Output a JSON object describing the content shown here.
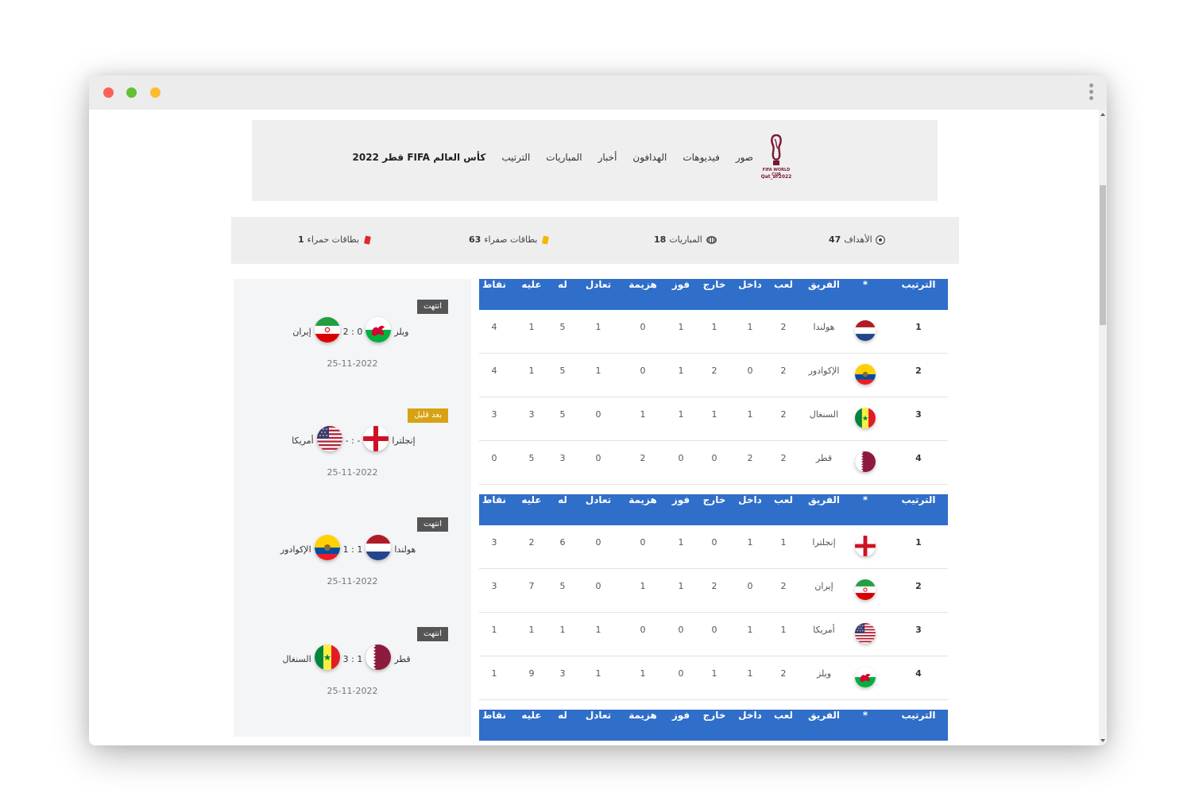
{
  "header": {
    "brand": "كأس العالم FIFA قطر 2022",
    "logo_text_1": "FIFA WORLD CUP",
    "logo_text_2": "Qat_ar2022",
    "nav": [
      "الترتيب",
      "المباريات",
      "أخبار",
      "الهدافون",
      "فيديوهات",
      "صور"
    ]
  },
  "stats": {
    "goals": {
      "label": "الأهداف",
      "value": "47"
    },
    "matches": {
      "label": "المباريات",
      "value": "18"
    },
    "yellow": {
      "label": "بطاقات صفراء",
      "value": "63"
    },
    "red": {
      "label": "بطاقات حمراء",
      "value": "1"
    }
  },
  "colors": {
    "accent": "#2f6ec9",
    "status_done": "#555555",
    "status_soon": "#d8a215"
  },
  "matches": [
    {
      "status": "انتهت",
      "status_type": "done",
      "home": "ويلز",
      "away": "إيران",
      "score": "2 : 0",
      "date": "25-11-2022",
      "home_flag": "wales",
      "away_flag": "iran"
    },
    {
      "status": "بعد قليل",
      "status_type": "soon",
      "home": "إنجلترا",
      "away": "أمريكا",
      "score": "- : -",
      "date": "25-11-2022",
      "home_flag": "england",
      "away_flag": "usa"
    },
    {
      "status": "انتهت",
      "status_type": "done",
      "home": "هولندا",
      "away": "الإكوادور",
      "score": "1 : 1",
      "date": "25-11-2022",
      "home_flag": "netherlands",
      "away_flag": "ecuador"
    },
    {
      "status": "انتهت",
      "status_type": "done",
      "home": "قطر",
      "away": "السنغال",
      "score": "3 : 1",
      "date": "25-11-2022",
      "home_flag": "qatar",
      "away_flag": "senegal"
    }
  ],
  "table_headers": [
    "الترتيب",
    "*",
    "الفريق",
    "لعب",
    "داخل",
    "خارج",
    "فوز",
    "هزيمة",
    "تعادل",
    "له",
    "عليه",
    "نقاط"
  ],
  "groups": [
    {
      "rows": [
        {
          "rank": "1",
          "flag": "netherlands",
          "team": "هولندا",
          "played": "2",
          "home": "1",
          "away": "1",
          "win": "1",
          "loss": "0",
          "draw": "1",
          "gf": "5",
          "ga": "1",
          "pts": "4"
        },
        {
          "rank": "2",
          "flag": "ecuador",
          "team": "الإكوادور",
          "played": "2",
          "home": "0",
          "away": "2",
          "win": "1",
          "loss": "0",
          "draw": "1",
          "gf": "5",
          "ga": "1",
          "pts": "4"
        },
        {
          "rank": "3",
          "flag": "senegal",
          "team": "السنغال",
          "played": "2",
          "home": "1",
          "away": "1",
          "win": "1",
          "loss": "1",
          "draw": "0",
          "gf": "5",
          "ga": "3",
          "pts": "3"
        },
        {
          "rank": "4",
          "flag": "qatar",
          "team": "قطر",
          "played": "2",
          "home": "2",
          "away": "0",
          "win": "0",
          "loss": "2",
          "draw": "0",
          "gf": "3",
          "ga": "5",
          "pts": "0"
        }
      ]
    },
    {
      "rows": [
        {
          "rank": "1",
          "flag": "england",
          "team": "إنجلترا",
          "played": "1",
          "home": "1",
          "away": "0",
          "win": "1",
          "loss": "0",
          "draw": "0",
          "gf": "6",
          "ga": "2",
          "pts": "3"
        },
        {
          "rank": "2",
          "flag": "iran",
          "team": "إيران",
          "played": "2",
          "home": "0",
          "away": "2",
          "win": "1",
          "loss": "1",
          "draw": "0",
          "gf": "5",
          "ga": "7",
          "pts": "3"
        },
        {
          "rank": "3",
          "flag": "usa",
          "team": "أمريكا",
          "played": "1",
          "home": "1",
          "away": "0",
          "win": "0",
          "loss": "0",
          "draw": "1",
          "gf": "1",
          "ga": "1",
          "pts": "1"
        },
        {
          "rank": "4",
          "flag": "wales",
          "team": "ويلز",
          "played": "2",
          "home": "1",
          "away": "1",
          "win": "0",
          "loss": "1",
          "draw": "1",
          "gf": "3",
          "ga": "9",
          "pts": "1"
        }
      ]
    },
    {
      "rows": []
    }
  ]
}
